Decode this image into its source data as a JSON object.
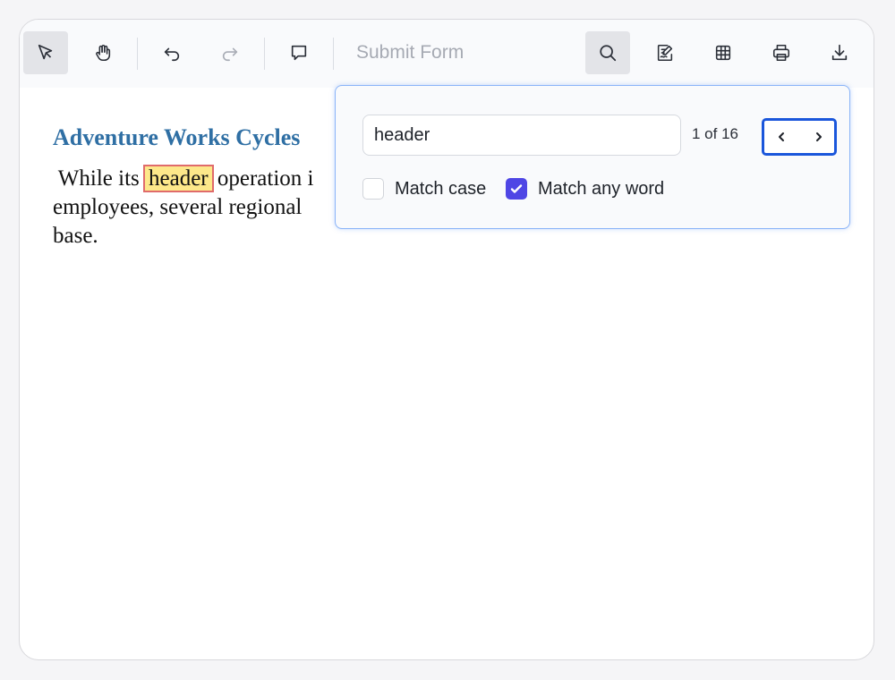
{
  "toolbar": {
    "submit_form_label": "Submit Form"
  },
  "document": {
    "title": "Adventure Works Cycles",
    "line1_before": " While its ",
    "line1_highlight": "header",
    "line1_after": " operation i",
    "line2": "employees, several regional",
    "line3": "base."
  },
  "find": {
    "query": "header",
    "count": "1 of 16",
    "match_case_label": "Match case",
    "match_case_checked": false,
    "match_any_word_label": "Match any word",
    "match_any_word_checked": true
  },
  "colors": {
    "accent": "#4f46e5",
    "focus_border": "#1a56db",
    "highlight": "#fde88a",
    "highlight_outline": "#e06b6b",
    "title": "#2f6fa4"
  }
}
